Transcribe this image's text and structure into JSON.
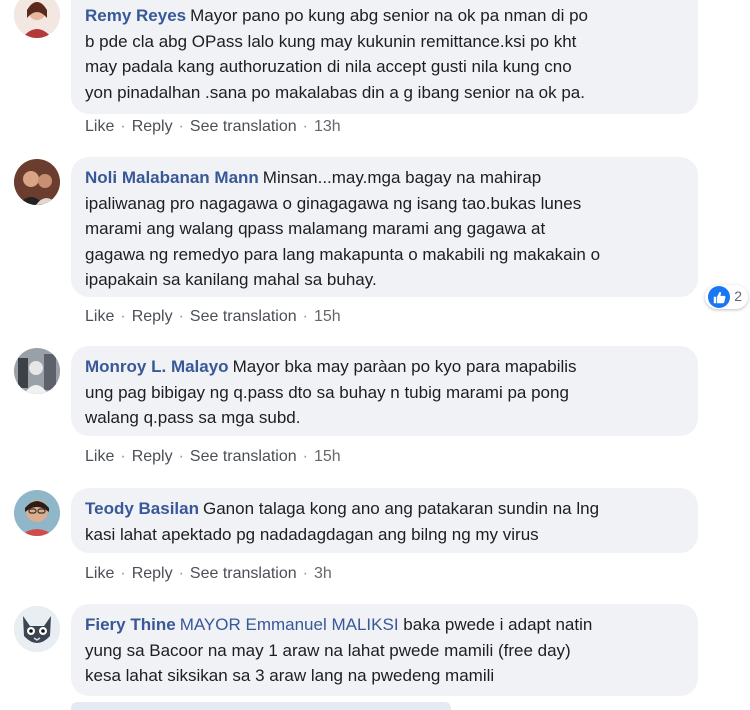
{
  "comments": [
    {
      "author": "Remy Reyes",
      "text": "Mayor pano po kung abg senior na ok pa nman di po b pde cla abg OPass lalo kung may kukunin remittance.ksi po kht may padala kang authoruzation di nila accept gusti nila kung cno yon pinadalhan .sana po makalabas din a g ibang senior na ok pa.",
      "lines": [
        "Mayor pano po kung abg senior na ok pa nman di po",
        "b pde cla abg OPass lalo kung may kukunin remittance.ksi po kht",
        "may padala kang authoruzation di nila accept gusti nila kung cno",
        "yon pinadalhan .sana po makalabas din a g ibang senior na ok pa."
      ],
      "time": "13h"
    },
    {
      "author": "Noli Malabanan Mann",
      "lines": [
        "Minsan...may.mga bagay na mahirap",
        "ipaliwanag pro nagagawa o ginagagawa ng isang tao.bukas lunes",
        "marami ang walang qpass malamang marami ang gagawa at",
        "gagawa ng remedyo para lang makapunta o makabili ng makakain o",
        "ipapakain sa kanilang mahal sa buhay."
      ],
      "time": "15h",
      "reaction_count": "2"
    },
    {
      "author": "Monroy L. Malayo",
      "lines": [
        "Mayor bka may paràan po kyo para mapabilis",
        "ung pag bibigay ng q.pass dto sa buhay n tubig marami pa pong",
        "walang q.pass sa mga subd."
      ],
      "time": "15h"
    },
    {
      "author": "Teody Basilan",
      "lines": [
        "Ganon talaga kong ano ang patakaran sundin na lng",
        "kasi lahat apektado pg nadadagdagan ang bilng ng my virus"
      ],
      "time": "3h"
    },
    {
      "author": "Fiery Thine",
      "mention": "MAYOR Emmanuel MALIKSI",
      "lines": [
        "baka pwede i adapt natin",
        "yung sa Bacoor na may 1 araw na lahat pwede mamili (free day)",
        "kesa lahat siksikan sa 3 araw lang na pwedeng mamili"
      ]
    }
  ],
  "actions": {
    "like": "Like",
    "reply": "Reply",
    "see_translation": "See translation",
    "separator": "·"
  },
  "colors": {
    "author": "#385898",
    "bubble": "#f0f2f5",
    "like_blue": "#1877f2"
  }
}
